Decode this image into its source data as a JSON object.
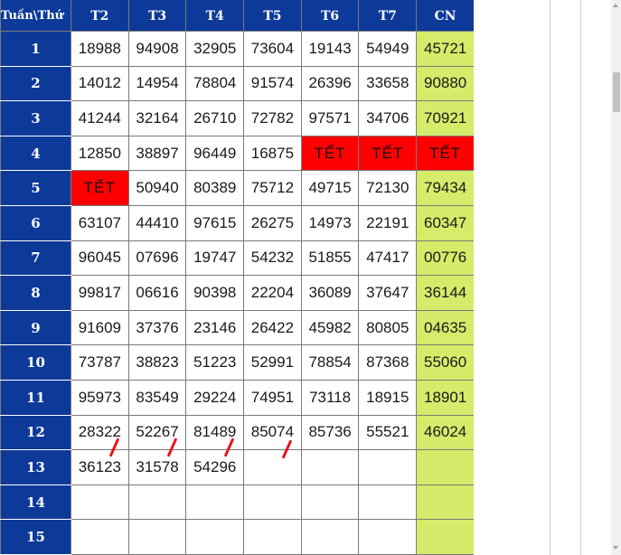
{
  "table": {
    "corner_label": "Tuần\\Thứ",
    "day_headers": [
      "T2",
      "T3",
      "T4",
      "T5",
      "T6",
      "T7",
      "CN"
    ],
    "rows": [
      {
        "week": "1",
        "cells": [
          "18988",
          "94908",
          "32905",
          "73604",
          "19143",
          "54949",
          "45721"
        ]
      },
      {
        "week": "2",
        "cells": [
          "14012",
          "14954",
          "78804",
          "91574",
          "26396",
          "33658",
          "90880"
        ]
      },
      {
        "week": "3",
        "cells": [
          "41244",
          "32164",
          "26710",
          "72782",
          "97571",
          "34706",
          "70921"
        ]
      },
      {
        "week": "4",
        "cells": [
          "12850",
          "38897",
          "96449",
          "16875",
          "TẾT",
          "TẾT",
          "TẾT"
        ]
      },
      {
        "week": "5",
        "cells": [
          "TẾT",
          "50940",
          "80389",
          "75712",
          "49715",
          "72130",
          "79434"
        ]
      },
      {
        "week": "6",
        "cells": [
          "63107",
          "44410",
          "97615",
          "26275",
          "14973",
          "22191",
          "60347"
        ]
      },
      {
        "week": "7",
        "cells": [
          "96045",
          "07696",
          "19747",
          "54232",
          "51855",
          "47417",
          "00776"
        ]
      },
      {
        "week": "8",
        "cells": [
          "99817",
          "06616",
          "90398",
          "22204",
          "36089",
          "37647",
          "36144"
        ]
      },
      {
        "week": "9",
        "cells": [
          "91609",
          "37376",
          "23146",
          "26422",
          "45982",
          "80805",
          "04635"
        ]
      },
      {
        "week": "10",
        "cells": [
          "73787",
          "38823",
          "51223",
          "52991",
          "78854",
          "87368",
          "55060"
        ]
      },
      {
        "week": "11",
        "cells": [
          "95973",
          "83549",
          "29224",
          "74951",
          "73118",
          "18915",
          "18901"
        ]
      },
      {
        "week": "12",
        "cells": [
          "28322",
          "52267",
          "81489",
          "85074",
          "85736",
          "55521",
          "46024"
        ]
      },
      {
        "week": "13",
        "cells": [
          "36123",
          "31578",
          "54296",
          "",
          "",
          "",
          ""
        ]
      },
      {
        "week": "14",
        "cells": [
          "",
          "",
          "",
          "",
          "",
          "",
          ""
        ]
      },
      {
        "week": "15",
        "cells": [
          "",
          "",
          "",
          "",
          "",
          "",
          ""
        ]
      }
    ]
  },
  "colors": {
    "header_bg": "#0d3a99",
    "sunday_bg": "#d4ec6a",
    "holiday_bg": "#ff0000",
    "annotation_red": "#e8141b"
  },
  "holiday_text": "TẾT",
  "annotations": {
    "red_slash_marks_count": 4
  }
}
